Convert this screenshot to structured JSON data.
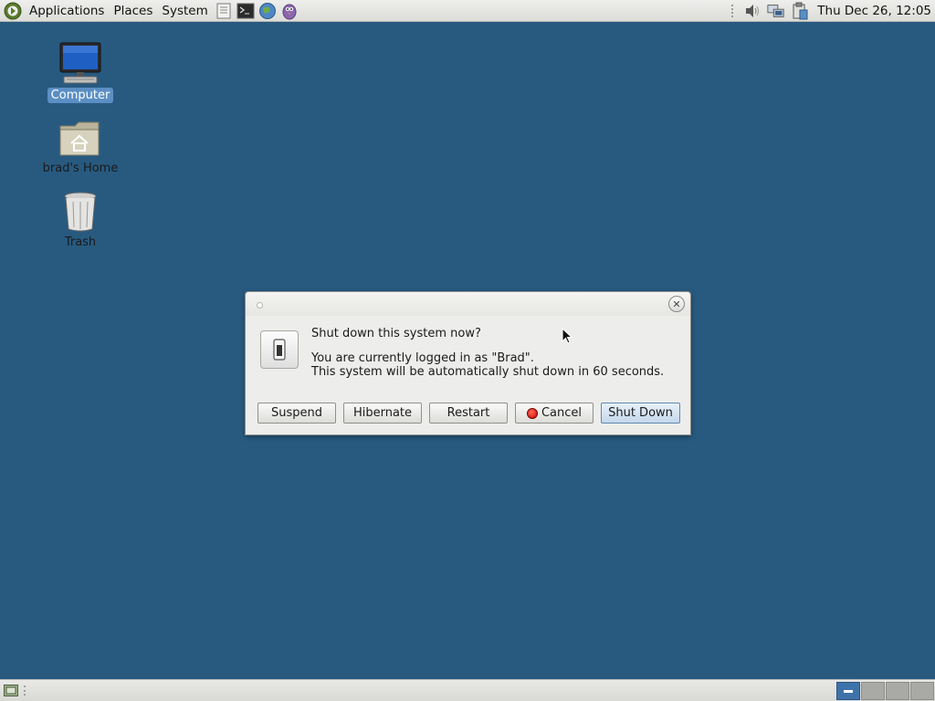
{
  "top_panel": {
    "menus": [
      "Applications",
      "Places",
      "System"
    ],
    "launchers": [
      "text-editor-icon",
      "terminal-icon",
      "browser-icon",
      "pidgin-icon"
    ],
    "tray": [
      "volume-icon",
      "network-icon",
      "clipboard-icon"
    ],
    "clock": "Thu Dec 26, 12:05"
  },
  "desktop": {
    "icons": [
      {
        "label": "Computer",
        "icon": "computer-icon",
        "selected": true
      },
      {
        "label": "brad's Home",
        "icon": "home-folder-icon",
        "selected": false
      },
      {
        "label": "Trash",
        "icon": "trash-icon",
        "selected": false
      }
    ]
  },
  "dialog": {
    "question": "Shut down this system now?",
    "message_line1": "You are currently logged in as \"Brad\".",
    "message_line2": "This system will be automatically shut down in 60 seconds.",
    "countdown_seconds": 60,
    "buttons": {
      "suspend": "Suspend",
      "hibernate": "Hibernate",
      "restart": "Restart",
      "cancel": "Cancel",
      "shutdown": "Shut Down"
    },
    "default_button": "Shut Down"
  },
  "bottom_panel": {
    "workspaces": 4,
    "active_workspace": 1
  },
  "colors": {
    "desktop_bg": "#285a80",
    "selection": "#5b8fc4",
    "default_button": "#c4d8ec"
  }
}
